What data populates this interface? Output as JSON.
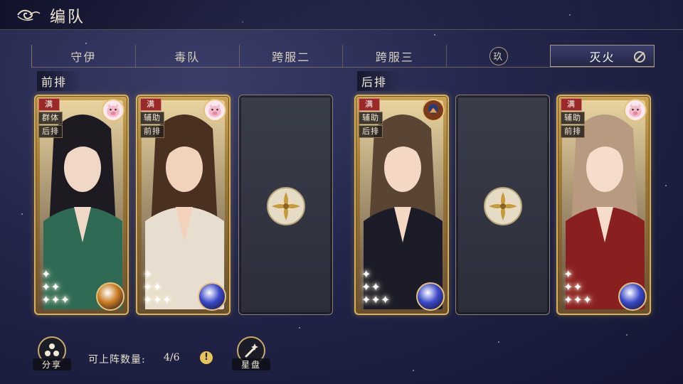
{
  "header": {
    "title": "编队"
  },
  "tabs": [
    {
      "label": "守伊",
      "active": false
    },
    {
      "label": "毒队",
      "active": false
    },
    {
      "label": "跨服二",
      "active": false
    },
    {
      "label": "跨服三",
      "active": false
    },
    {
      "label": "玖",
      "active": false,
      "badge": true
    },
    {
      "label": "灭火",
      "active": true
    }
  ],
  "rows": {
    "front": "前排",
    "back": "后排"
  },
  "cards": [
    {
      "tags": [
        "满",
        "群体",
        "后排"
      ],
      "hair": "#1e1a22",
      "robe": "#2f6a55",
      "skin": "#f1d7c6",
      "orb": "#c97a20",
      "badge": "pig"
    },
    {
      "tags": [
        "满",
        "辅助",
        "前排"
      ],
      "hair": "#4a3020",
      "robe": "#e8ded0",
      "skin": "#f3d2bb",
      "orb": "#3a48c8",
      "badge": "pig"
    },
    {
      "empty": true
    },
    {
      "tags": [
        "满",
        "辅助",
        "后排"
      ],
      "hair": "#5a4535",
      "robe": "#1c1c28",
      "skin": "#f4d8c4",
      "orb": "#3a48c8",
      "badge": "bird"
    },
    {
      "empty": true
    },
    {
      "tags": [
        "满",
        "辅助",
        "前排"
      ],
      "hair": "#b89a80",
      "robe": "#8a1f20",
      "skin": "#f5dccb",
      "orb": "#3a48c8",
      "badge": "pig"
    }
  ],
  "bottom": {
    "share_label": "分享",
    "count_label": "可上阵数量:",
    "count_value": "4/6",
    "info_label": "!",
    "starmap_label": "星盘"
  },
  "colors": {
    "gold": "#d9b25a",
    "bg": "#23264a",
    "full_tag": "#9a2a2a"
  }
}
